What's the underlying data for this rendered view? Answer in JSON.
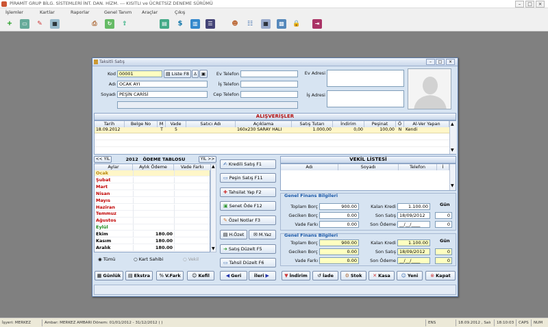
{
  "app": {
    "title": "PİRAMİT GRUP BİLG. SİSTEMLERİ İNT. DAN. HİZM.  ---  KISITLI ve ÜCRETSİZ DENEME SÜRÜMÜ"
  },
  "menu": [
    "İşlemler",
    "Kartlar",
    "Raporlar",
    "Genel Tanım",
    "Araçlar",
    "Çıkış"
  ],
  "window": {
    "title": "Taksitli Satış"
  },
  "customer": {
    "kod_label": "Kod",
    "kod_value": "00001",
    "liste_button": "Liste F8",
    "adi_label": "Adı",
    "adi_value": "OCAK AYI",
    "soyadi_label": "Soyadı",
    "soyadi_value": "PEŞİN CARİSİ",
    "ev_telefon_label": "Ev Telefon",
    "is_telefon_label": "İş Telefon",
    "cep_telefon_label": "Cep Telefon",
    "ev_adresi_label": "Ev Adresi",
    "is_adresi_label": "İş Adresi"
  },
  "purchases": {
    "title": "ALIŞVERİŞLER",
    "columns": [
      "Tarih",
      "Belge No",
      "M",
      "Vade",
      "Satıcı Adı",
      "Açıklama",
      "Satış Tutarı",
      "İndirim",
      "Peşinat",
      "Ö",
      "Al-Ver Yapan"
    ],
    "rows": [
      [
        "18.09.2012",
        "",
        "T",
        "5",
        "",
        "160x230 SARAY HALI",
        "1.000,00",
        "0,00",
        "100,00",
        "N",
        "Kendi"
      ]
    ]
  },
  "payment_table": {
    "prev_year": "<< YIL",
    "year": "2012",
    "title": "ÖDEME TABLOSU",
    "next_year": "YIL >>",
    "columns": [
      "Aylar",
      "Aylık Ödeme",
      "Vade Farkı"
    ],
    "months": [
      {
        "name": "Ocak",
        "amount": "",
        "color": "#b8860b"
      },
      {
        "name": "Şubat",
        "amount": "",
        "color": "#c00000"
      },
      {
        "name": "Mart",
        "amount": "",
        "color": "#c00000"
      },
      {
        "name": "Nisan",
        "amount": "",
        "color": "#c00000"
      },
      {
        "name": "Mayıs",
        "amount": "",
        "color": "#c00000"
      },
      {
        "name": "Haziran",
        "amount": "",
        "color": "#c00000"
      },
      {
        "name": "Temmuz",
        "amount": "",
        "color": "#c00000"
      },
      {
        "name": "Ağustos",
        "amount": "",
        "color": "#c00000"
      },
      {
        "name": "Eylül",
        "amount": "",
        "color": "#1a8a1a"
      },
      {
        "name": "Ekim",
        "amount": "180.00",
        "color": "#000000"
      },
      {
        "name": "Kasım",
        "amount": "180.00",
        "color": "#000000"
      },
      {
        "name": "Aralık",
        "amount": "180.00",
        "color": "#000000"
      }
    ],
    "radios": [
      "Tümü",
      "Kart Sahibi",
      "Vekil"
    ]
  },
  "actions": {
    "kredili_satis": "Kredili Satış  F1",
    "pesin_satis": "Peşin Satış  F11",
    "tahsilat_yap": "Tahsilat Yap  F2",
    "senet_ode": "Senet Öde  F12",
    "ozel_notlar": "Özel Notlar  F3",
    "h_ozet": "H.Özet",
    "m_yaz": "M.Yaz",
    "satis_duzelt": "Satış Düzelt  F5",
    "tahsil_duzelt": "Tahsil Düzelt F6",
    "geri": "Geri",
    "ileri": "İleri"
  },
  "bottom_left": {
    "gunluk": "Günlük",
    "ekstra": "Ekstra",
    "v_fark": "V.Fark",
    "kefil": "Kefil"
  },
  "bottom_right": {
    "indirim": "İndirim",
    "iade": "İade",
    "stok": "Stok",
    "kasa": "Kasa",
    "yeni": "Yeni",
    "kapat": "Kapat"
  },
  "vekil": {
    "title": "VEKİL LİSTESİ",
    "columns": [
      "Adı",
      "Soyadı",
      "Telefon",
      "İ"
    ]
  },
  "finance1": {
    "title": "Genel Finans Bilgileri",
    "toplam_borc_label": "Toplam Borç",
    "toplam_borc": "900.00",
    "geciken_borc_label": "Geciken Borç",
    "geciken_borc": "0.00",
    "vade_farki_label": "Vade Farkı",
    "vade_farki": "0.00",
    "kalan_kredi_label": "Kalan Kredi",
    "kalan_kredi": "1.100.00",
    "son_satis_label": "Son Satış",
    "son_satis": "18/09/2012",
    "son_odeme_label": "Son Ödeme",
    "son_odeme": "__/__/____",
    "gun_label": "Gün",
    "gun1": "0",
    "gun2": "0"
  },
  "finance2": {
    "title": "Genel Finans Bilgileri",
    "toplam_borc_label": "Toplam Borç",
    "toplam_borc": "900.00",
    "geciken_borc_label": "Geciken Borç",
    "geciken_borc": "0.00",
    "vade_farki_label": "Vade Farkı",
    "vade_farki": "0.00",
    "kalan_kredi_label": "Kalan Kredi",
    "kalan_kredi": "1.100.00",
    "son_satis_label": "Son Satış",
    "son_satis": "18/09/2012",
    "son_odeme_label": "Son Ödeme",
    "son_odeme": "__/__/____",
    "gun_label": "Gün",
    "gun1": "0",
    "gun2": "0"
  },
  "status": {
    "isyeri": "İşyeri: MERKEZ",
    "ambar": "Ambar: MERKEZ AMBARI  Dönem: 01/01/2012 - 31/12/2012 ( )",
    "mode": "ENS",
    "date": "18.09.2012 , Salı",
    "time": "18:10:03",
    "caps": "CAPS",
    "num": "NUM"
  }
}
